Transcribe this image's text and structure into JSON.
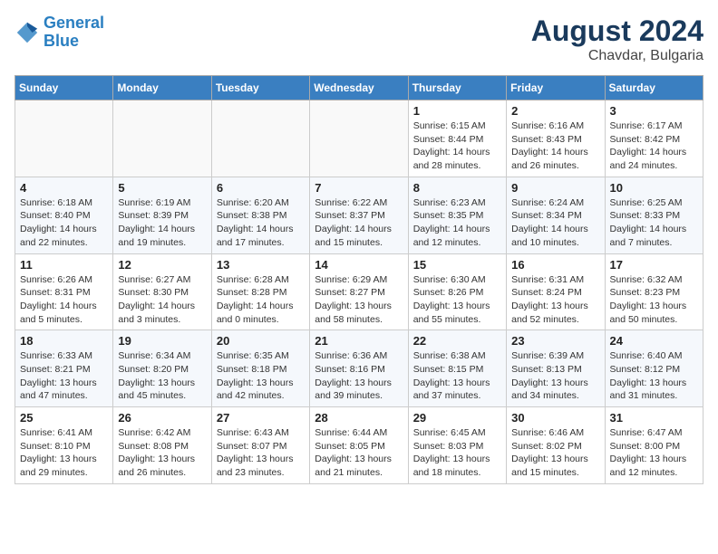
{
  "header": {
    "logo_line1": "General",
    "logo_line2": "Blue",
    "month_year": "August 2024",
    "location": "Chavdar, Bulgaria"
  },
  "weekdays": [
    "Sunday",
    "Monday",
    "Tuesday",
    "Wednesday",
    "Thursday",
    "Friday",
    "Saturday"
  ],
  "weeks": [
    [
      {
        "day": "",
        "info": ""
      },
      {
        "day": "",
        "info": ""
      },
      {
        "day": "",
        "info": ""
      },
      {
        "day": "",
        "info": ""
      },
      {
        "day": "1",
        "info": "Sunrise: 6:15 AM\nSunset: 8:44 PM\nDaylight: 14 hours\nand 28 minutes."
      },
      {
        "day": "2",
        "info": "Sunrise: 6:16 AM\nSunset: 8:43 PM\nDaylight: 14 hours\nand 26 minutes."
      },
      {
        "day": "3",
        "info": "Sunrise: 6:17 AM\nSunset: 8:42 PM\nDaylight: 14 hours\nand 24 minutes."
      }
    ],
    [
      {
        "day": "4",
        "info": "Sunrise: 6:18 AM\nSunset: 8:40 PM\nDaylight: 14 hours\nand 22 minutes."
      },
      {
        "day": "5",
        "info": "Sunrise: 6:19 AM\nSunset: 8:39 PM\nDaylight: 14 hours\nand 19 minutes."
      },
      {
        "day": "6",
        "info": "Sunrise: 6:20 AM\nSunset: 8:38 PM\nDaylight: 14 hours\nand 17 minutes."
      },
      {
        "day": "7",
        "info": "Sunrise: 6:22 AM\nSunset: 8:37 PM\nDaylight: 14 hours\nand 15 minutes."
      },
      {
        "day": "8",
        "info": "Sunrise: 6:23 AM\nSunset: 8:35 PM\nDaylight: 14 hours\nand 12 minutes."
      },
      {
        "day": "9",
        "info": "Sunrise: 6:24 AM\nSunset: 8:34 PM\nDaylight: 14 hours\nand 10 minutes."
      },
      {
        "day": "10",
        "info": "Sunrise: 6:25 AM\nSunset: 8:33 PM\nDaylight: 14 hours\nand 7 minutes."
      }
    ],
    [
      {
        "day": "11",
        "info": "Sunrise: 6:26 AM\nSunset: 8:31 PM\nDaylight: 14 hours\nand 5 minutes."
      },
      {
        "day": "12",
        "info": "Sunrise: 6:27 AM\nSunset: 8:30 PM\nDaylight: 14 hours\nand 3 minutes."
      },
      {
        "day": "13",
        "info": "Sunrise: 6:28 AM\nSunset: 8:28 PM\nDaylight: 14 hours\nand 0 minutes."
      },
      {
        "day": "14",
        "info": "Sunrise: 6:29 AM\nSunset: 8:27 PM\nDaylight: 13 hours\nand 58 minutes."
      },
      {
        "day": "15",
        "info": "Sunrise: 6:30 AM\nSunset: 8:26 PM\nDaylight: 13 hours\nand 55 minutes."
      },
      {
        "day": "16",
        "info": "Sunrise: 6:31 AM\nSunset: 8:24 PM\nDaylight: 13 hours\nand 52 minutes."
      },
      {
        "day": "17",
        "info": "Sunrise: 6:32 AM\nSunset: 8:23 PM\nDaylight: 13 hours\nand 50 minutes."
      }
    ],
    [
      {
        "day": "18",
        "info": "Sunrise: 6:33 AM\nSunset: 8:21 PM\nDaylight: 13 hours\nand 47 minutes."
      },
      {
        "day": "19",
        "info": "Sunrise: 6:34 AM\nSunset: 8:20 PM\nDaylight: 13 hours\nand 45 minutes."
      },
      {
        "day": "20",
        "info": "Sunrise: 6:35 AM\nSunset: 8:18 PM\nDaylight: 13 hours\nand 42 minutes."
      },
      {
        "day": "21",
        "info": "Sunrise: 6:36 AM\nSunset: 8:16 PM\nDaylight: 13 hours\nand 39 minutes."
      },
      {
        "day": "22",
        "info": "Sunrise: 6:38 AM\nSunset: 8:15 PM\nDaylight: 13 hours\nand 37 minutes."
      },
      {
        "day": "23",
        "info": "Sunrise: 6:39 AM\nSunset: 8:13 PM\nDaylight: 13 hours\nand 34 minutes."
      },
      {
        "day": "24",
        "info": "Sunrise: 6:40 AM\nSunset: 8:12 PM\nDaylight: 13 hours\nand 31 minutes."
      }
    ],
    [
      {
        "day": "25",
        "info": "Sunrise: 6:41 AM\nSunset: 8:10 PM\nDaylight: 13 hours\nand 29 minutes."
      },
      {
        "day": "26",
        "info": "Sunrise: 6:42 AM\nSunset: 8:08 PM\nDaylight: 13 hours\nand 26 minutes."
      },
      {
        "day": "27",
        "info": "Sunrise: 6:43 AM\nSunset: 8:07 PM\nDaylight: 13 hours\nand 23 minutes."
      },
      {
        "day": "28",
        "info": "Sunrise: 6:44 AM\nSunset: 8:05 PM\nDaylight: 13 hours\nand 21 minutes."
      },
      {
        "day": "29",
        "info": "Sunrise: 6:45 AM\nSunset: 8:03 PM\nDaylight: 13 hours\nand 18 minutes."
      },
      {
        "day": "30",
        "info": "Sunrise: 6:46 AM\nSunset: 8:02 PM\nDaylight: 13 hours\nand 15 minutes."
      },
      {
        "day": "31",
        "info": "Sunrise: 6:47 AM\nSunset: 8:00 PM\nDaylight: 13 hours\nand 12 minutes."
      }
    ]
  ]
}
